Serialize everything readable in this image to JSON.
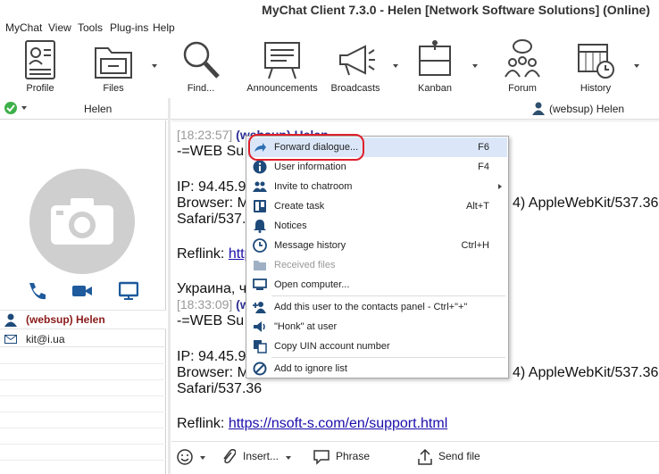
{
  "window": {
    "title": "MyChat Client 7.3.0 - Helen [Network Software Solutions] (Online)"
  },
  "menu": [
    "MyChat",
    "View",
    "Tools",
    "Plug-ins",
    "Help"
  ],
  "toolbar": {
    "profile": "Profile",
    "files": "Files",
    "find": "Find...",
    "announcements": "Announcements",
    "broadcasts": "Broadcasts",
    "kanban": "Kanban",
    "forum": "Forum",
    "history": "History"
  },
  "status": {
    "user": "Helen",
    "chat_peer": "(websup) Helen"
  },
  "contact": {
    "name": "(websup) Helen",
    "email": "kit@i.ua"
  },
  "chat": {
    "m1_time": "[18:23:57]",
    "m1_name": "(websup) Helen",
    "m1_line1": "-=WEB Su",
    "m1_ip": "IP: 94.45.9",
    "m1_browser_a": "Browser: M",
    "m1_browser_b": "4) AppleWebKit/537.36",
    "m1_safari": "Safari/537.",
    "m1_reflink": "Reflink:",
    "m1_link": "http",
    "m1_country": "Украина, ч",
    "m2_time": "[18:33:09]",
    "m2_name": "(w",
    "m2_line1": "-=WEB Su",
    "m2_ip": "IP: 94.45.9",
    "m2_browser_a": "Browser: M",
    "m2_browser_b": "4) AppleWebKit/537.36",
    "m2_safari": "Safari/537.36",
    "m2_reflink": "Reflink:",
    "m2_link": "https://nsoft-s.com/en/support.html"
  },
  "context_menu": {
    "items": [
      {
        "label": "Forward dialogue...",
        "shortcut": "F6",
        "icon": "forward-icon"
      },
      {
        "label": "User information",
        "shortcut": "F4",
        "icon": "info-icon"
      },
      {
        "label": "Invite to chatroom",
        "shortcut": "",
        "icon": "group-icon"
      },
      {
        "label": "Create task",
        "shortcut": "Alt+T",
        "icon": "kanban-icon"
      },
      {
        "label": "Notices",
        "shortcut": "",
        "icon": "bell-icon"
      },
      {
        "label": "Message history",
        "shortcut": "Ctrl+H",
        "icon": "clock-icon"
      },
      {
        "label": "Received files",
        "shortcut": "",
        "icon": "folder-icon"
      },
      {
        "label": "Open computer...",
        "shortcut": "",
        "icon": "computer-icon"
      },
      {
        "label": "Add this user to the contacts panel - Ctrl+\"+\"",
        "shortcut": "",
        "icon": "add-contact-icon"
      },
      {
        "label": "\"Honk\" at user",
        "shortcut": "",
        "icon": "speaker-icon"
      },
      {
        "label": "Copy UIN account number",
        "shortcut": "",
        "icon": "copy-icon"
      },
      {
        "label": "Add to ignore list",
        "shortcut": "",
        "icon": "block-icon"
      }
    ]
  },
  "bottombar": {
    "insert": "Insert...",
    "phrase": "Phrase",
    "send_file": "Send file"
  },
  "colors": {
    "accent": "#2e6fb4",
    "highlight": "#dbe7f8",
    "callout": "#e0202a",
    "username": "#8b1a1a"
  }
}
